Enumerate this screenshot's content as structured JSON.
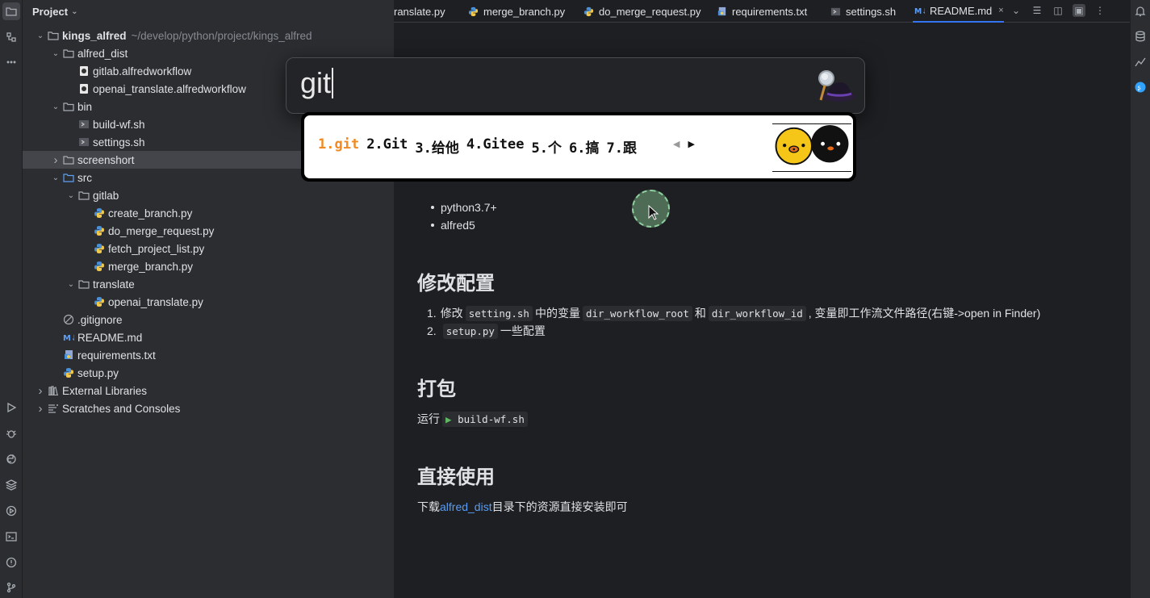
{
  "project_panel": {
    "title": "Project",
    "tree": [
      {
        "label": "kings_alfred",
        "path": "~/develop/python/project/kings_alfred",
        "depth": 0,
        "arrow": "down",
        "icon": "folder-icon",
        "bold": true
      },
      {
        "label": "alfred_dist",
        "depth": 1,
        "arrow": "down",
        "icon": "folder-icon"
      },
      {
        "label": "gitlab.alfredworkflow",
        "depth": 2,
        "arrow": "",
        "icon": "workflow-file-icon"
      },
      {
        "label": "openai_translate.alfredworkflow",
        "depth": 2,
        "arrow": "",
        "icon": "workflow-file-icon"
      },
      {
        "label": "bin",
        "depth": 1,
        "arrow": "down",
        "icon": "folder-icon"
      },
      {
        "label": "build-wf.sh",
        "depth": 2,
        "arrow": "",
        "icon": "shell-file-icon"
      },
      {
        "label": "settings.sh",
        "depth": 2,
        "arrow": "",
        "icon": "shell-file-icon"
      },
      {
        "label": "screenshort",
        "depth": 1,
        "arrow": "right",
        "icon": "folder-icon",
        "selected": true
      },
      {
        "label": "src",
        "depth": 1,
        "arrow": "down",
        "icon": "source-folder-icon"
      },
      {
        "label": "gitlab",
        "depth": 2,
        "arrow": "down",
        "icon": "folder-icon"
      },
      {
        "label": "create_branch.py",
        "depth": 3,
        "arrow": "",
        "icon": "python-file-icon"
      },
      {
        "label": "do_merge_request.py",
        "depth": 3,
        "arrow": "",
        "icon": "python-file-icon"
      },
      {
        "label": "fetch_project_list.py",
        "depth": 3,
        "arrow": "",
        "icon": "python-file-icon"
      },
      {
        "label": "merge_branch.py",
        "depth": 3,
        "arrow": "",
        "icon": "python-file-icon"
      },
      {
        "label": "translate",
        "depth": 2,
        "arrow": "down",
        "icon": "folder-icon"
      },
      {
        "label": "openai_translate.py",
        "depth": 3,
        "arrow": "",
        "icon": "python-file-icon"
      },
      {
        "label": ".gitignore",
        "depth": 1,
        "arrow": "",
        "icon": "gitignore-file-icon"
      },
      {
        "label": "README.md",
        "depth": 1,
        "arrow": "",
        "icon": "markdown-file-icon"
      },
      {
        "label": "requirements.txt",
        "depth": 1,
        "arrow": "",
        "icon": "requirements-file-icon"
      },
      {
        "label": "setup.py",
        "depth": 1,
        "arrow": "",
        "icon": "python-file-icon"
      },
      {
        "label": "External Libraries",
        "depth": 0,
        "arrow": "right",
        "icon": "library-icon"
      },
      {
        "label": "Scratches and Consoles",
        "depth": 0,
        "arrow": "right",
        "icon": "scratches-icon"
      }
    ]
  },
  "tabs": [
    {
      "label": "ranslate.py",
      "icon": "",
      "active": false
    },
    {
      "label": "merge_branch.py",
      "icon": "python-file-icon",
      "active": false
    },
    {
      "label": "do_merge_request.py",
      "icon": "python-file-icon",
      "active": false
    },
    {
      "label": "requirements.txt",
      "icon": "requirements-file-icon",
      "active": false
    },
    {
      "label": "settings.sh",
      "icon": "shell-file-icon",
      "active": false
    },
    {
      "label": "README.md",
      "icon": "markdown-file-icon",
      "active": true,
      "close": "×"
    }
  ],
  "readme": {
    "requirements": [
      "python3.7+",
      "alfred5"
    ],
    "config_heading": "修改配置",
    "config_items": [
      {
        "num": "1.",
        "pre": "修改",
        "code1": "setting.sh",
        "mid": "中的变量",
        "code2": "dir_workflow_root",
        "and": "和",
        "code3": "dir_workflow_id",
        "post": ", 变量即工作流文件路径(右键->open in Finder)"
      },
      {
        "num": "2.",
        "code1": "setup.py",
        "post": "一些配置"
      }
    ],
    "package_heading": "打包",
    "package_line": {
      "pre": "运行",
      "code": "build-wf.sh"
    },
    "direct_heading": "直接使用",
    "direct_line": {
      "pre": "下载",
      "link": "alfred_dist",
      "post": "目录下的资源直接安装即可"
    }
  },
  "alfred": {
    "query": "git",
    "icon": "alfred-hat-icon"
  },
  "ime": {
    "candidates": [
      "1.git",
      "2.Git",
      "3.给他",
      "4.Gitee",
      "5.个",
      "6.搞",
      "7.跟"
    ],
    "prev": "◀",
    "next": "▶",
    "accent": "#f08a24"
  }
}
